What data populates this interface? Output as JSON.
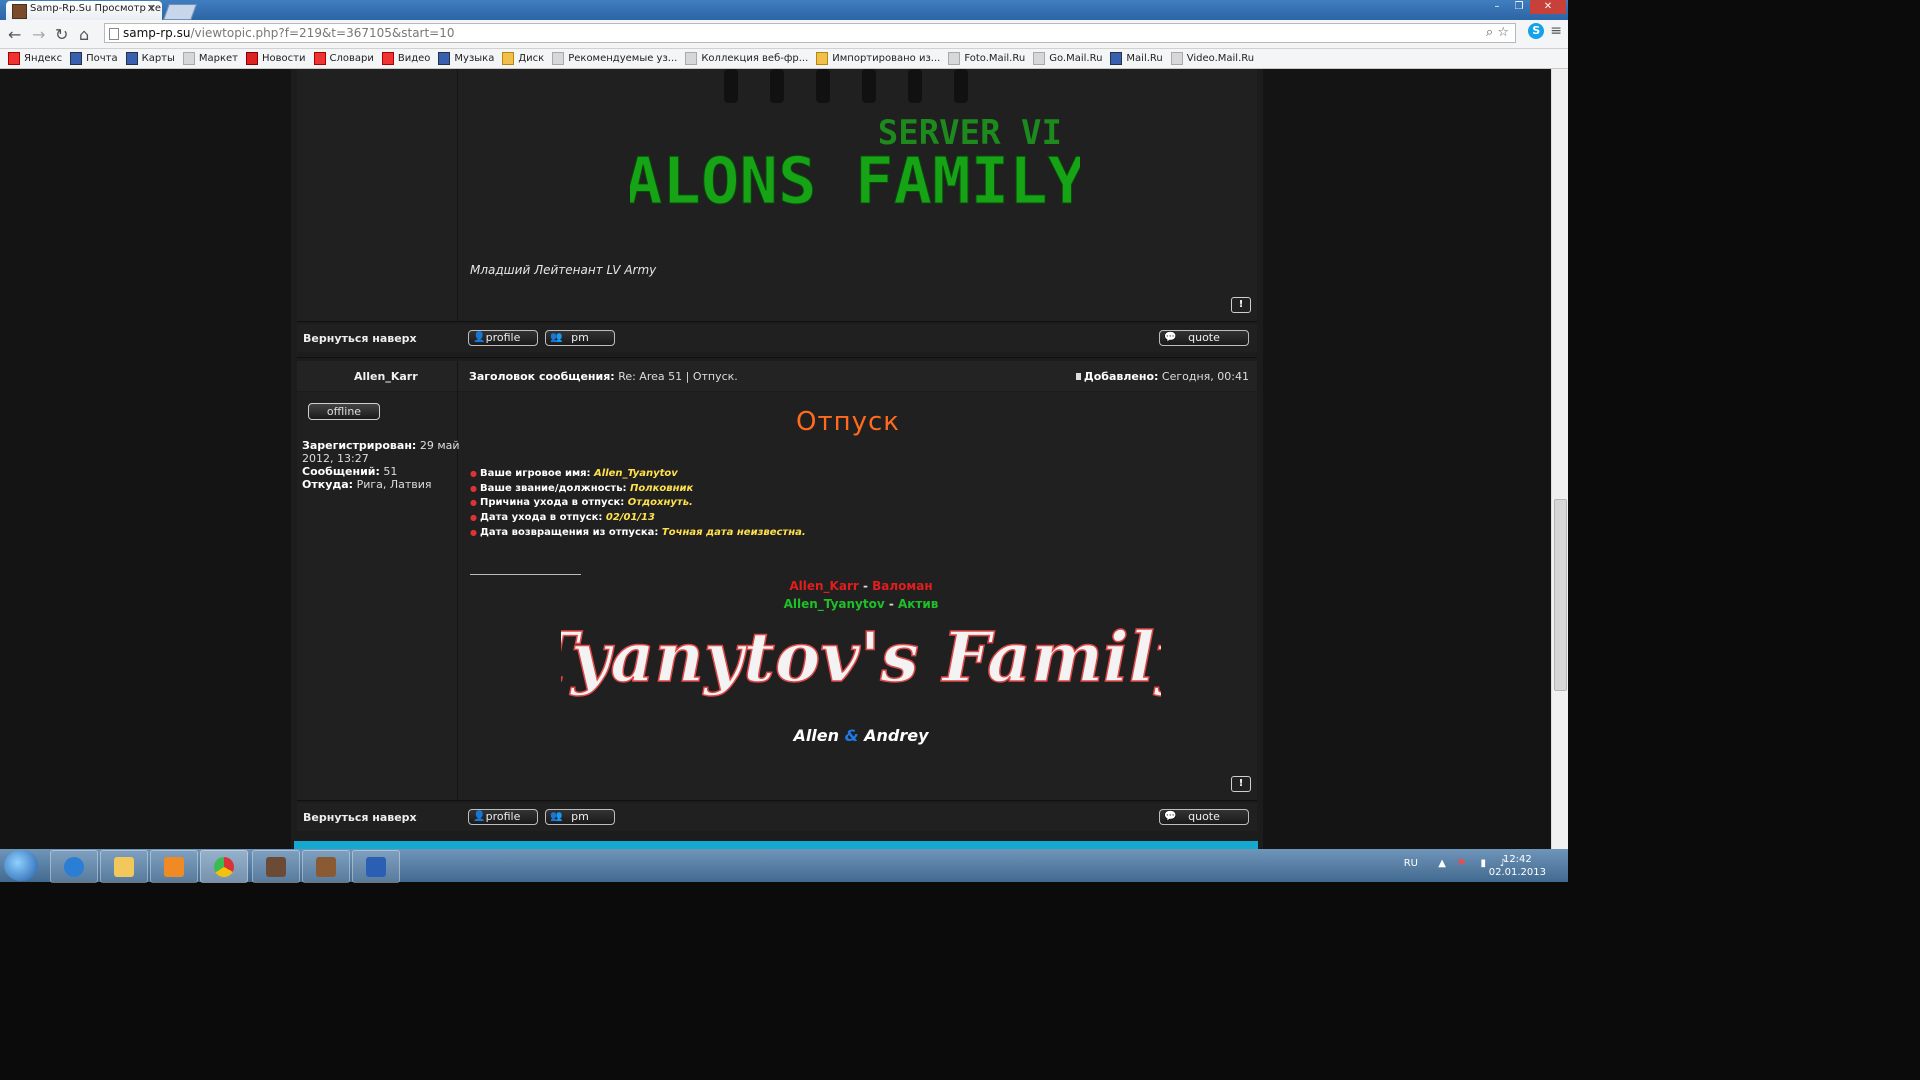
{
  "browser": {
    "tab_title": "Samp-Rp.Su Просмотр те",
    "url_host": "samp-rp.su",
    "url_path": "/viewtopic.php?f=219&t=367105&start=10",
    "bookmarks": [
      "Яндекс",
      "Почта",
      "Карты",
      "Маркет",
      "Новости",
      "Словари",
      "Видео",
      "Музыка",
      "Диск",
      "Рекомендуемые уз...",
      "Коллекция веб-фр...",
      "Импортировано из...",
      "Foto.Mail.Ru",
      "Go.Mail.Ru",
      "Mail.Ru",
      "Video.Mail.Ru"
    ]
  },
  "post1": {
    "signature_text": "ALONS FAMILY",
    "signature_sub": "SERVER VI",
    "rank": "Младший Лейтенант LV Army",
    "back_to_top": "Вернуться наверх",
    "profile_btn": "profile",
    "pm_btn": "pm",
    "quote_btn": "quote"
  },
  "post2": {
    "author": "Allen_Karr",
    "status": "offline",
    "subject_label": "Заголовок сообщения:",
    "subject": "Re: Area 51 | Отпуск.",
    "added_label": "Добавлено:",
    "added": "Сегодня, 00:41",
    "profile": {
      "registered_label": "Зарегистрирован:",
      "registered": "29 май 2012, 13:27",
      "posts_label": "Сообщений:",
      "posts": "51",
      "from_label": "Откуда:",
      "from": "Рига, Латвия"
    },
    "title": "Отпуск",
    "form": [
      {
        "label": "Ваше игровое имя:",
        "value": "Allen_Tyanytov"
      },
      {
        "label": "Ваше звание/должность:",
        "value": "Полковник"
      },
      {
        "label": "Причина ухода в отпуск:",
        "value": "Отдохнуть."
      },
      {
        "label": "Дата ухода в отпуск:",
        "value": "02/01/13"
      },
      {
        "label": "Дата возвращения из отпуска:",
        "value": "Точная дата неизвестна."
      }
    ],
    "rel1_name": "Allen_Karr",
    "rel1_dash": " - ",
    "rel1_value": "Валоман",
    "rel2_name": "Allen_Tyanytov",
    "rel2_dash": " - ",
    "rel2_value": "Актив",
    "family_text": "Tyanytov's Family",
    "couple_a": "Allen",
    "couple_amp": "&",
    "couple_b": "Andrey",
    "back_to_top": "Вернуться наверх",
    "profile_btn": "profile",
    "pm_btn": "pm",
    "quote_btn": "quote"
  },
  "taskbar": {
    "lang": "RU",
    "time": "12:42",
    "date": "02.01.2013"
  },
  "colors": {
    "accent_orange": "#ff6a1c",
    "value_yellow": "#ffe14d",
    "green": "#1fbf28",
    "red": "#e11d1d"
  }
}
